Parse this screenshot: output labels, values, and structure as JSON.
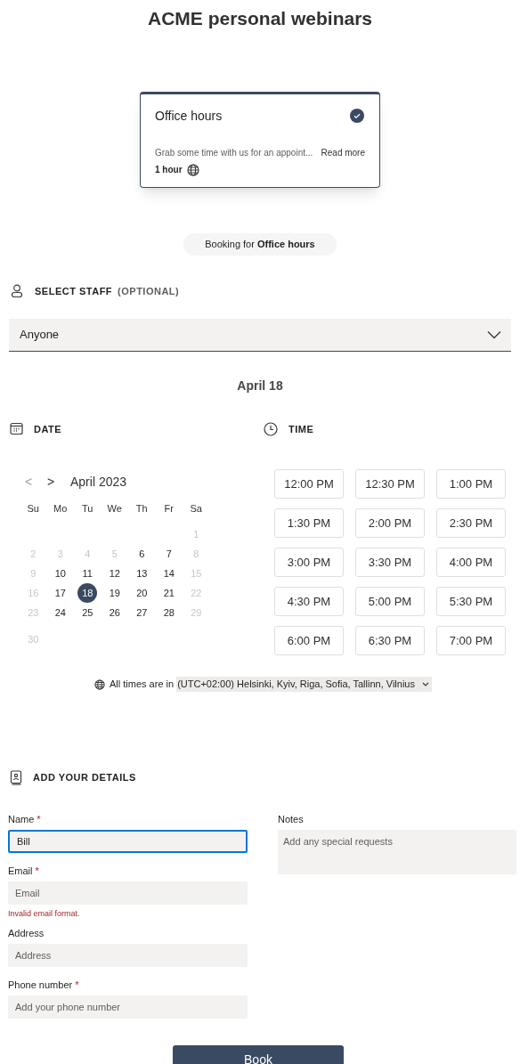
{
  "title": "ACME personal webinars",
  "service": {
    "name": "Office hours",
    "selected": true,
    "description": "Grab some time with us for an appoint...",
    "read_more": "Read more",
    "duration": "1 hour"
  },
  "booking_for": {
    "prefix": "Booking for",
    "service": "Office hours"
  },
  "staff": {
    "heading": "SELECT STAFF",
    "note": "(OPTIONAL)",
    "value": "Anyone"
  },
  "selected_date": "April 18",
  "date": {
    "heading": "DATE",
    "prev": "<",
    "next": ">",
    "month": "April 2023",
    "weekdays": [
      "Su",
      "Mo",
      "Tu",
      "We",
      "Th",
      "Fr",
      "Sa"
    ],
    "weeks": [
      [
        {
          "kind": "blank"
        },
        {
          "kind": "blank"
        },
        {
          "kind": "blank"
        },
        {
          "kind": "blank"
        },
        {
          "kind": "blank"
        },
        {
          "kind": "blank"
        },
        {
          "kind": "day",
          "day": "1",
          "disabled": true,
          "selected": false
        }
      ],
      [
        {
          "kind": "day",
          "day": "2",
          "disabled": true,
          "selected": false
        },
        {
          "kind": "day",
          "day": "3",
          "disabled": true,
          "selected": false
        },
        {
          "kind": "day",
          "day": "4",
          "disabled": true,
          "selected": false
        },
        {
          "kind": "day",
          "day": "5",
          "disabled": true,
          "selected": false
        },
        {
          "kind": "day",
          "day": "6",
          "disabled": false,
          "selected": false
        },
        {
          "kind": "day",
          "day": "7",
          "disabled": false,
          "selected": false
        },
        {
          "kind": "day",
          "day": "8",
          "disabled": true,
          "selected": false
        }
      ],
      [
        {
          "kind": "day",
          "day": "9",
          "disabled": true,
          "selected": false
        },
        {
          "kind": "day",
          "day": "10",
          "disabled": false,
          "selected": false
        },
        {
          "kind": "day",
          "day": "11",
          "disabled": false,
          "selected": false
        },
        {
          "kind": "day",
          "day": "12",
          "disabled": false,
          "selected": false
        },
        {
          "kind": "day",
          "day": "13",
          "disabled": false,
          "selected": false
        },
        {
          "kind": "day",
          "day": "14",
          "disabled": false,
          "selected": false
        },
        {
          "kind": "day",
          "day": "15",
          "disabled": true,
          "selected": false
        }
      ],
      [
        {
          "kind": "day",
          "day": "16",
          "disabled": true,
          "selected": false
        },
        {
          "kind": "day",
          "day": "17",
          "disabled": false,
          "selected": false
        },
        {
          "kind": "day",
          "day": "18",
          "disabled": false,
          "selected": true
        },
        {
          "kind": "day",
          "day": "19",
          "disabled": false,
          "selected": false
        },
        {
          "kind": "day",
          "day": "20",
          "disabled": false,
          "selected": false
        },
        {
          "kind": "day",
          "day": "21",
          "disabled": false,
          "selected": false
        },
        {
          "kind": "day",
          "day": "22",
          "disabled": true,
          "selected": false
        }
      ],
      [
        {
          "kind": "day",
          "day": "23",
          "disabled": true,
          "selected": false
        },
        {
          "kind": "day",
          "day": "24",
          "disabled": false,
          "selected": false
        },
        {
          "kind": "day",
          "day": "25",
          "disabled": false,
          "selected": false
        },
        {
          "kind": "day",
          "day": "26",
          "disabled": false,
          "selected": false
        },
        {
          "kind": "day",
          "day": "27",
          "disabled": false,
          "selected": false
        },
        {
          "kind": "day",
          "day": "28",
          "disabled": false,
          "selected": false
        },
        {
          "kind": "day",
          "day": "29",
          "disabled": true,
          "selected": false
        }
      ],
      [
        {
          "kind": "day",
          "day": "30",
          "disabled": true,
          "selected": false
        }
      ]
    ]
  },
  "time": {
    "heading": "TIME",
    "slots": [
      "12:00 PM",
      "12:30 PM",
      "1:00 PM",
      "1:30 PM",
      "2:00 PM",
      "2:30 PM",
      "3:00 PM",
      "3:30 PM",
      "4:00 PM",
      "4:30 PM",
      "5:00 PM",
      "5:30 PM",
      "6:00 PM",
      "6:30 PM",
      "7:00 PM"
    ]
  },
  "timezone": {
    "prefix": "All times are in",
    "value": "(UTC+02:00) Helsinki, Kyiv, Riga, Sofia, Tallinn, Vilnius"
  },
  "details": {
    "heading": "ADD YOUR DETAILS",
    "fields": [
      {
        "label": "Name",
        "required_mark": "*",
        "value": "Bill",
        "focused": true
      },
      {
        "label": "Email",
        "required_mark": "*",
        "placeholder": "Email",
        "focused": false,
        "error": "Invalid email format."
      },
      {
        "label": "Address",
        "placeholder": "Address",
        "focused": false
      },
      {
        "label": "Phone number",
        "required_mark": "*",
        "placeholder": "Add your phone number",
        "focused": false
      }
    ],
    "notes": {
      "label": "Notes",
      "placeholder": "Add any special requests"
    }
  },
  "book_button": "Book"
}
